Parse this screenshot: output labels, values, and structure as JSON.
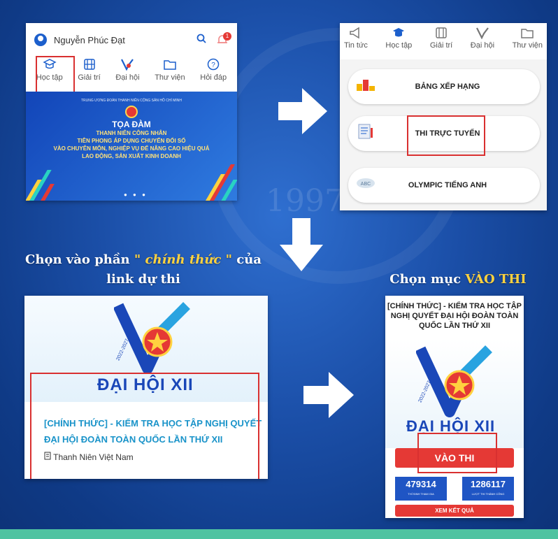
{
  "panel1": {
    "user_name": "Nguyễn Phúc Đạt",
    "notification_count": "1",
    "tabs": [
      {
        "label": "Học tập",
        "icon": "graduation-cap-icon"
      },
      {
        "label": "Giải trí",
        "icon": "film-icon"
      },
      {
        "label": "Đại hội",
        "icon": "congress-logo-icon"
      },
      {
        "label": "Thư viện",
        "icon": "folder-icon"
      },
      {
        "label": "Hỏi đáp",
        "icon": "question-icon"
      }
    ],
    "banner": {
      "org": "TRUNG ƯƠNG ĐOÀN THANH NIÊN CỘNG SẢN HỒ CHÍ MINH",
      "heading": "TỌA ĐÀM",
      "lines": [
        "THANH NIÊN CÔNG NHÂN",
        "TIÊN PHONG ÁP DỤNG CHUYỂN ĐỔI SỐ",
        "VÀO CHUYÊN MÔN, NGHIỆP VỤ ĐỂ NÂNG CAO HIỆU QUẢ",
        "LAO ĐỘNG, SẢN XUẤT KINH DOANH"
      ]
    }
  },
  "panel2": {
    "tabs": [
      {
        "label": "Tin tức",
        "icon": "megaphone-icon"
      },
      {
        "label": "Học tập",
        "icon": "graduation-cap-icon"
      },
      {
        "label": "Giải trí",
        "icon": "film-icon"
      },
      {
        "label": "Đại hội",
        "icon": "congress-logo-icon"
      },
      {
        "label": "Thư viện",
        "icon": "folder-icon"
      }
    ],
    "menu": [
      {
        "label": "BẢNG XẾP HẠNG",
        "icon": "ranking-icon"
      },
      {
        "label": "THI TRỰC TUYẾN",
        "icon": "online-test-icon"
      },
      {
        "label": "OLYMPIC TIẾNG ANH",
        "icon": "english-icon"
      }
    ]
  },
  "watermark": {
    "year": "1997"
  },
  "heading_left": {
    "prefix": "Chọn vào phần",
    "accent": "\" chính thức \"",
    "suffix": "của",
    "line2": "link dự thi"
  },
  "heading_right": {
    "prefix": "Chọn mục",
    "accent": "VÀO THI"
  },
  "panel3": {
    "logo_text": "ĐẠI HỘI XII",
    "years": "2022-2027",
    "title": "[CHÍNH THỨC] - KIỂM TRA HỌC TẬP NGHỊ QUYẾT ĐẠI HỘI ĐOÀN TOÀN QUỐC LẦN THỨ XII",
    "source": "Thanh Niên Việt Nam"
  },
  "panel4": {
    "title": "[CHÍNH THỨC] - KIỂM TRA HỌC TẬP NGHỊ QUYẾT ĐẠI HỘI ĐOÀN TOÀN QUỐC LẦN THỨ XII",
    "logo_text": "ĐẠI HỘI XII",
    "years": "2022-2027",
    "enter_button": "VÀO THI",
    "stats": [
      {
        "value": "479314",
        "label": "THÍ SINH THAM GIA"
      },
      {
        "value": "1286117",
        "label": "LƯỢT THI THÀNH CÔNG"
      }
    ],
    "results_button": "XEM KẾT QUẢ"
  },
  "colors": {
    "background": "#1b4fa8",
    "highlight": "#d93030",
    "accent_yellow": "#ffd23f",
    "primary_blue": "#1c5fcc",
    "button_red": "#e53935"
  }
}
